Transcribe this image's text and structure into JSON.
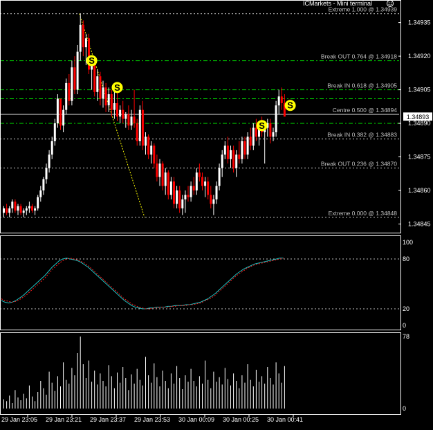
{
  "header": {
    "title": "ICMarkets - Mini terminal",
    "smiley_icon": "smiley-icon"
  },
  "colors": {
    "background": "#000000",
    "axis": "#ffffff",
    "grid_green": "#00c000",
    "grid_dashed": "#c0c0c0",
    "bull_candle": "#ffffff",
    "bear_candle": "#ff0000",
    "signal_marker": "#ffff00",
    "stoch_main": "#20c0c0",
    "stoch_signal": "#ff2020",
    "volume": "#ffffff",
    "fib_diagonal": "#ffff00"
  },
  "price_panel": {
    "price_ticks": [
      "1.34935",
      "1.34920",
      "1.34905",
      "1.34890",
      "1.34875",
      "1.34860",
      "1.34845"
    ],
    "current_price": "1.34893",
    "levels": [
      {
        "label": "Extreme 1.000 @ 1.34939",
        "price": 1.34939,
        "style": "dashed"
      },
      {
        "label": "Break OUT 0.764 @ 1.34918",
        "price": 1.34918,
        "style": "green"
      },
      {
        "label": "Break IN 0.618 @ 1.34905",
        "price": 1.34905,
        "style": "green"
      },
      {
        "label": "",
        "price": 1.34901,
        "style": "green"
      },
      {
        "label": "Centre 0.500 @ 1.34894",
        "price": 1.34894,
        "style": "white"
      },
      {
        "label": "",
        "price": 1.3489,
        "style": "green"
      },
      {
        "label": "Break IN 0.382 @ 1.34883",
        "price": 1.34883,
        "style": "dashed"
      },
      {
        "label": "Break OUT 0.236 @ 1.34870",
        "price": 1.3487,
        "style": "dashed"
      },
      {
        "label": "Extreme 0.000 @ 1.34848",
        "price": 1.34848,
        "style": "dashed"
      }
    ],
    "signals": [
      {
        "label": "S",
        "bar": 31,
        "price": 1.34918
      },
      {
        "label": "S",
        "bar": 40,
        "price": 1.34906
      },
      {
        "label": "S",
        "bar": 91,
        "price": 1.34889
      },
      {
        "label": "S",
        "bar": 101,
        "price": 1.34898
      }
    ]
  },
  "stochastic_panel": {
    "ticks": [
      "100",
      "80",
      "20",
      "0"
    ],
    "levels": [
      80,
      20
    ]
  },
  "volume_panel": {
    "ticks": [
      "78",
      "0"
    ]
  },
  "time_axis": {
    "labels": [
      "29 Jan 23:05",
      "29 Jan 23:21",
      "29 Jan 23:37",
      "29 Jan 23:53",
      "30 Jan 00:09",
      "30 Jan 00:25",
      "30 Jan 00:41"
    ]
  },
  "chart_data": {
    "type": "candlestick",
    "title": "ICMarkets - Mini terminal",
    "ylim": [
      1.34843,
      1.34942
    ],
    "x_labels": [
      "29 Jan 23:05",
      "29 Jan 23:21",
      "29 Jan 23:37",
      "29 Jan 23:53",
      "30 Jan 00:09",
      "30 Jan 00:25",
      "30 Jan 00:41"
    ],
    "ohlc": [
      [
        1.3485,
        1.34853,
        1.34848,
        1.34852
      ],
      [
        1.34852,
        1.34854,
        1.34849,
        1.3485
      ],
      [
        1.3485,
        1.34853,
        1.34848,
        1.34852
      ],
      [
        1.34852,
        1.34856,
        1.3485,
        1.34855
      ],
      [
        1.34855,
        1.34856,
        1.3485,
        1.34851
      ],
      [
        1.34851,
        1.34854,
        1.34849,
        1.34853
      ],
      [
        1.34853,
        1.34854,
        1.34849,
        1.3485
      ],
      [
        1.3485,
        1.34852,
        1.34848,
        1.34851
      ],
      [
        1.34851,
        1.34853,
        1.34849,
        1.34852
      ],
      [
        1.34852,
        1.34855,
        1.3485,
        1.34853
      ],
      [
        1.34853,
        1.34854,
        1.3485,
        1.34851
      ],
      [
        1.34851,
        1.34853,
        1.34849,
        1.34852
      ],
      [
        1.34852,
        1.34858,
        1.34851,
        1.34857
      ],
      [
        1.34857,
        1.34862,
        1.34855,
        1.3486
      ],
      [
        1.3486,
        1.34866,
        1.34858,
        1.34865
      ],
      [
        1.34865,
        1.34872,
        1.34863,
        1.3487
      ],
      [
        1.3487,
        1.34878,
        1.34868,
        1.34876
      ],
      [
        1.34876,
        1.34884,
        1.34874,
        1.34882
      ],
      [
        1.34882,
        1.34892,
        1.3488,
        1.3489
      ],
      [
        1.3489,
        1.34903,
        1.34888,
        1.34901
      ],
      [
        1.34901,
        1.349,
        1.34887,
        1.34889
      ],
      [
        1.34889,
        1.34898,
        1.34886,
        1.34896
      ],
      [
        1.34896,
        1.3491,
        1.34894,
        1.34908
      ],
      [
        1.34908,
        1.34912,
        1.34898,
        1.349
      ],
      [
        1.349,
        1.34918,
        1.34898,
        1.34915
      ],
      [
        1.34915,
        1.3492,
        1.34903,
        1.34905
      ],
      [
        1.34905,
        1.34925,
        1.34903,
        1.34922
      ],
      [
        1.34922,
        1.34939,
        1.34918,
        1.34934
      ],
      [
        1.34934,
        1.34936,
        1.3492,
        1.34924
      ],
      [
        1.34924,
        1.3493,
        1.34916,
        1.34928
      ],
      [
        1.34928,
        1.3493,
        1.34912,
        1.34914
      ],
      [
        1.34914,
        1.3492,
        1.34905,
        1.34917
      ],
      [
        1.34917,
        1.34919,
        1.34902,
        1.34904
      ],
      [
        1.34904,
        1.34914,
        1.349,
        1.34911
      ],
      [
        1.34911,
        1.34913,
        1.34898,
        1.34901
      ],
      [
        1.34901,
        1.34909,
        1.34897,
        1.34906
      ],
      [
        1.34906,
        1.34908,
        1.34895,
        1.34898
      ],
      [
        1.34898,
        1.34906,
        1.34895,
        1.34903
      ],
      [
        1.34903,
        1.34905,
        1.34893,
        1.34896
      ],
      [
        1.34896,
        1.34904,
        1.34892,
        1.34899
      ],
      [
        1.34899,
        1.34906,
        1.34891,
        1.34893
      ],
      [
        1.34893,
        1.34898,
        1.3489,
        1.34896
      ],
      [
        1.34896,
        1.349,
        1.3489,
        1.34892
      ],
      [
        1.34892,
        1.34895,
        1.34888,
        1.34894
      ],
      [
        1.34894,
        1.34898,
        1.34887,
        1.34889
      ],
      [
        1.34889,
        1.34896,
        1.34887,
        1.34893
      ],
      [
        1.34893,
        1.34905,
        1.34888,
        1.3489
      ],
      [
        1.3489,
        1.34892,
        1.3488,
        1.34882
      ],
      [
        1.34882,
        1.34898,
        1.3488,
        1.34896
      ],
      [
        1.34896,
        1.349,
        1.34878,
        1.3488
      ],
      [
        1.3488,
        1.34886,
        1.34876,
        1.34884
      ],
      [
        1.34884,
        1.34885,
        1.34874,
        1.34876
      ],
      [
        1.34876,
        1.34882,
        1.34872,
        1.3488
      ],
      [
        1.3488,
        1.34881,
        1.3487,
        1.34872
      ],
      [
        1.34872,
        1.34876,
        1.34864,
        1.34866
      ],
      [
        1.34866,
        1.34874,
        1.34862,
        1.34872
      ],
      [
        1.34872,
        1.34873,
        1.3486,
        1.34862
      ],
      [
        1.34862,
        1.3487,
        1.34858,
        1.34868
      ],
      [
        1.34868,
        1.34869,
        1.34856,
        1.34858
      ],
      [
        1.34858,
        1.34866,
        1.34856,
        1.34864
      ],
      [
        1.34864,
        1.34866,
        1.34852,
        1.34854
      ],
      [
        1.34854,
        1.34862,
        1.34852,
        1.3486
      ],
      [
        1.3486,
        1.34862,
        1.3485,
        1.34852
      ],
      [
        1.34852,
        1.34858,
        1.34849,
        1.34856
      ],
      [
        1.34856,
        1.3486,
        1.3485,
        1.34858
      ],
      [
        1.34858,
        1.34862,
        1.34855,
        1.34857
      ],
      [
        1.34857,
        1.34864,
        1.34855,
        1.34862
      ],
      [
        1.34862,
        1.34866,
        1.34858,
        1.3486
      ],
      [
        1.3486,
        1.3487,
        1.34858,
        1.34868
      ],
      [
        1.34868,
        1.34872,
        1.34864,
        1.34866
      ],
      [
        1.34866,
        1.34868,
        1.3486,
        1.34862
      ],
      [
        1.34862,
        1.34866,
        1.34857,
        1.34864
      ],
      [
        1.34864,
        1.34866,
        1.34856,
        1.34858
      ],
      [
        1.34858,
        1.34862,
        1.34852,
        1.34854
      ],
      [
        1.34854,
        1.34858,
        1.34849,
        1.34856
      ],
      [
        1.34856,
        1.34864,
        1.34854,
        1.34862
      ],
      [
        1.34862,
        1.34872,
        1.3486,
        1.3487
      ],
      [
        1.3487,
        1.34878,
        1.34866,
        1.34876
      ],
      [
        1.34876,
        1.34882,
        1.34874,
        1.3488
      ],
      [
        1.3488,
        1.34884,
        1.34872,
        1.34874
      ],
      [
        1.34874,
        1.3488,
        1.3487,
        1.34878
      ],
      [
        1.34878,
        1.3488,
        1.34868,
        1.3487
      ],
      [
        1.3487,
        1.34878,
        1.34866,
        1.34876
      ],
      [
        1.34876,
        1.34882,
        1.34872,
        1.34874
      ],
      [
        1.34874,
        1.34884,
        1.34872,
        1.34882
      ],
      [
        1.34882,
        1.34884,
        1.34874,
        1.34876
      ],
      [
        1.34876,
        1.34886,
        1.34874,
        1.34884
      ],
      [
        1.34884,
        1.34888,
        1.34878,
        1.3488
      ],
      [
        1.3488,
        1.3489,
        1.34878,
        1.34888
      ],
      [
        1.34888,
        1.34892,
        1.34882,
        1.34884
      ],
      [
        1.34884,
        1.3489,
        1.3488,
        1.34888
      ],
      [
        1.34888,
        1.34893,
        1.34884,
        1.34886
      ],
      [
        1.34886,
        1.3489,
        1.34872,
        1.34888
      ],
      [
        1.34888,
        1.34892,
        1.34884,
        1.3489
      ],
      [
        1.3489,
        1.34892,
        1.34881,
        1.34884
      ],
      [
        1.34884,
        1.34888,
        1.34882,
        1.34886
      ],
      [
        1.34886,
        1.349,
        1.34884,
        1.34898
      ],
      [
        1.34898,
        1.34905,
        1.34894,
        1.34902
      ],
      [
        1.34902,
        1.34906,
        1.34896,
        1.34899
      ],
      [
        1.34899,
        1.34903,
        1.34893,
        1.34893
      ]
    ],
    "stochastic": {
      "main": [
        30,
        28,
        27,
        28,
        30,
        33,
        36,
        40,
        44,
        48,
        52,
        56,
        60,
        65,
        70,
        74,
        78,
        80,
        81,
        80,
        79,
        78,
        76,
        73,
        70,
        66,
        62,
        58,
        54,
        50,
        46,
        42,
        38,
        34,
        30,
        27,
        24,
        22,
        21,
        20,
        20,
        21,
        21,
        22,
        22,
        22,
        23,
        23,
        24,
        24,
        24,
        25,
        25,
        26,
        27,
        28,
        30,
        32,
        35,
        38,
        42,
        46,
        50,
        54,
        58,
        62,
        65,
        68,
        70,
        72,
        74,
        75,
        76,
        77,
        78,
        79,
        80,
        81,
        81
      ],
      "signal": [
        32,
        30,
        29,
        28,
        29,
        31,
        34,
        37,
        41,
        45,
        49,
        53,
        57,
        62,
        67,
        71,
        75,
        78,
        80,
        81,
        80,
        79,
        77,
        75,
        72,
        68,
        64,
        60,
        56,
        52,
        48,
        44,
        40,
        36,
        32,
        29,
        26,
        24,
        22,
        21,
        20,
        20,
        21,
        21,
        22,
        22,
        22,
        23,
        23,
        24,
        24,
        24,
        25,
        25,
        26,
        27,
        29,
        31,
        33,
        36,
        40,
        44,
        48,
        52,
        56,
        60,
        63,
        66,
        69,
        71,
        73,
        74,
        75,
        76,
        77,
        78,
        79,
        80,
        81
      ]
    },
    "volume": [
      10,
      8,
      14,
      6,
      20,
      12,
      9,
      16,
      11,
      25,
      13,
      8,
      18,
      30,
      22,
      15,
      40,
      28,
      19,
      35,
      24,
      50,
      31,
      27,
      44,
      36,
      60,
      78,
      48,
      33,
      52,
      29,
      41,
      26,
      38,
      30,
      24,
      47,
      35,
      22,
      39,
      28,
      45,
      33,
      20,
      37,
      27,
      43,
      31,
      25,
      56,
      36,
      28,
      49,
      34,
      24,
      41,
      30,
      22,
      38,
      27,
      46,
      33,
      21,
      36,
      29,
      43,
      30,
      24,
      35,
      27,
      52,
      31,
      22,
      40,
      29,
      34,
      26,
      44,
      32,
      25,
      38,
      30,
      22,
      36,
      28,
      48,
      31,
      24,
      42,
      29,
      35,
      27,
      45,
      33,
      26,
      50,
      38,
      28,
      46
    ]
  }
}
